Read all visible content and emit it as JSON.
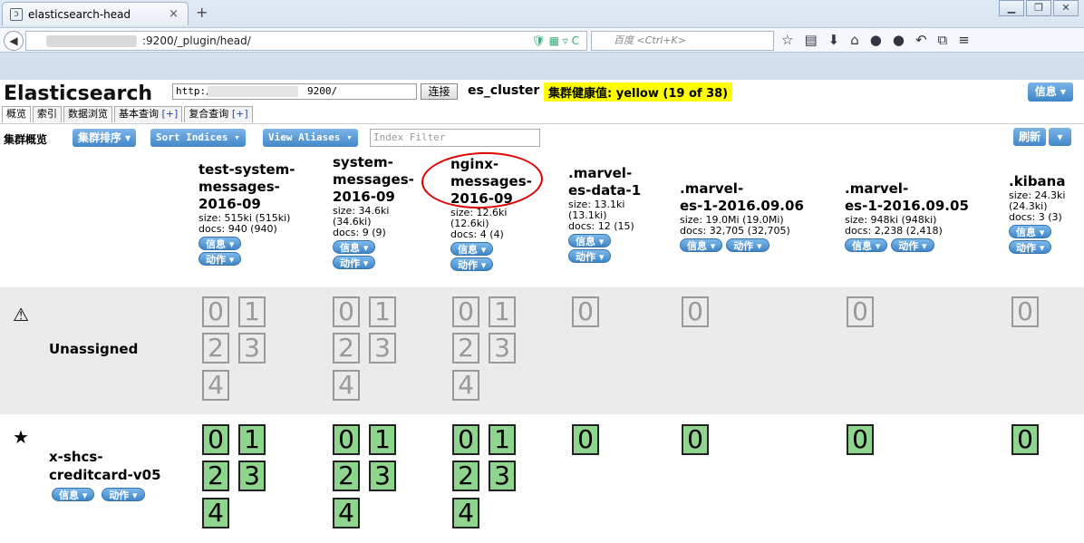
{
  "browser": {
    "tab_title": "elasticsearch-head",
    "tab_close": "×",
    "new_tab": "+",
    "url": ":9200/_plugin/head/",
    "search_placeholder": "百度 <Ctrl+K>"
  },
  "app": {
    "brand": "Elasticsearch",
    "address_prefix": "http:/.",
    "address_suffix": "9200/",
    "connect_label": "连接",
    "cluster_name": "es_cluster",
    "health": "集群健康值: yellow (19 of 38)",
    "info_label": "信息 ▾"
  },
  "tabs": [
    {
      "label": "概览",
      "plus": ""
    },
    {
      "label": "索引",
      "plus": ""
    },
    {
      "label": "数据浏览",
      "plus": ""
    },
    {
      "label": "基本查询",
      "plus": "[+]"
    },
    {
      "label": "复合查询",
      "plus": "[+]"
    }
  ],
  "toolbar": {
    "title": "集群概览",
    "sort_label": "集群排序 ▾",
    "sort_indices_label": "Sort Indices ▾",
    "view_aliases_label": "View Aliases ▾",
    "filter_placeholder": "Index Filter",
    "refresh_label": "刷新",
    "refresh_dd": "▾"
  },
  "indices": [
    {
      "name_lines": [
        "test-system-",
        "messages-",
        "2016-09"
      ],
      "size": "size: 515ki (515ki)",
      "size2": "",
      "docs": "docs: 940 (940)"
    },
    {
      "name_lines": [
        "system-",
        "messages-",
        "2016-09"
      ],
      "size": "size: 34.6ki",
      "size2": "(34.6ki)",
      "docs": "docs: 9 (9)"
    },
    {
      "name_lines": [
        "nginx-",
        "messages-",
        "2016-09"
      ],
      "size": "size: 12.6ki",
      "size2": "(12.6ki)",
      "docs": "docs: 4 (4)"
    },
    {
      "name_lines": [
        ".marvel-",
        "es-data-1"
      ],
      "size": "size: 13.1ki",
      "size2": "(13.1ki)",
      "docs": "docs: 12 (15)"
    },
    {
      "name_lines": [
        ".marvel-",
        "es-1-2016.09.06"
      ],
      "size": "size: 19.0Mi (19.0Mi)",
      "size2": "",
      "docs": "docs: 32,705 (32,705)"
    },
    {
      "name_lines": [
        ".marvel-",
        "es-1-2016.09.05"
      ],
      "size": "size: 948ki (948ki)",
      "size2": "",
      "docs": "docs: 2,238 (2,418)"
    },
    {
      "name_lines": [
        ".kibana"
      ],
      "size": "size: 24.3ki",
      "size2": "(24.3ki)",
      "docs": "docs: 3 (3)"
    }
  ],
  "pill_info": "信息 ▾",
  "pill_action": "动作 ▾",
  "rows": {
    "unassigned": {
      "icon": "⚠",
      "label": "Unassigned"
    },
    "node": {
      "icon": "★",
      "label_lines": [
        "x-shcs-",
        "creditcard-v05"
      ]
    }
  },
  "shards": {
    "s0": "0",
    "s1": "1",
    "s2": "2",
    "s3": "3",
    "s4": "4"
  }
}
